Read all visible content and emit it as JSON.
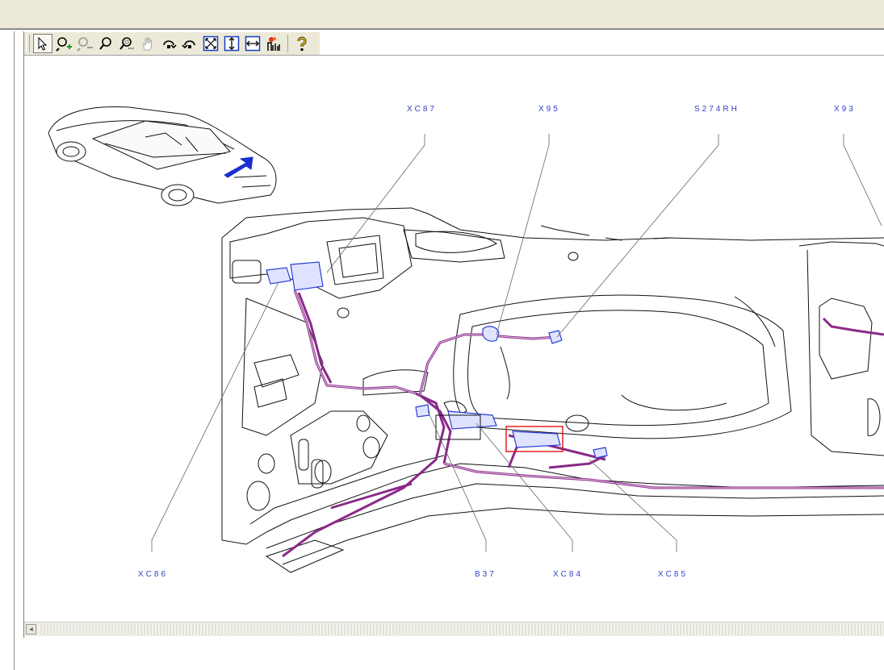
{
  "toolbar": {
    "buttons": [
      {
        "name": "select-pointer",
        "icon": "arrow-pointer-icon",
        "active": true
      },
      {
        "name": "zoom-in",
        "icon": "zoom-in-icon"
      },
      {
        "name": "zoom-out",
        "icon": "zoom-out-icon"
      },
      {
        "name": "zoom",
        "icon": "magnifier-icon"
      },
      {
        "name": "zoom-window",
        "icon": "zoom-window-icon"
      },
      {
        "name": "pan",
        "icon": "hand-icon"
      },
      {
        "name": "rotate-right",
        "icon": "rotate-right-icon"
      },
      {
        "name": "rotate-left",
        "icon": "rotate-left-icon"
      },
      {
        "name": "fit-all",
        "icon": "fit-all-icon"
      },
      {
        "name": "fit-height",
        "icon": "fit-height-icon"
      },
      {
        "name": "fit-width",
        "icon": "fit-width-icon"
      },
      {
        "name": "highlight",
        "icon": "highlight-icon"
      },
      {
        "name": "help",
        "icon": "help-icon"
      }
    ]
  },
  "diagram": {
    "labels": {
      "xc87": "XC87",
      "x95": "X95",
      "s274rh": "S274RH",
      "x93": "X93",
      "xc86": "XC86",
      "b37": "B37",
      "xc84": "XC84",
      "xc85": "XC85"
    },
    "colors": {
      "callout_text": "#3340c8",
      "harness": "#8a2a8a",
      "connector": "#2b3fd6",
      "highlight_box": "#e02020",
      "line_art": "#111111"
    }
  },
  "scrollbar": {
    "left_arrow": "◂"
  }
}
